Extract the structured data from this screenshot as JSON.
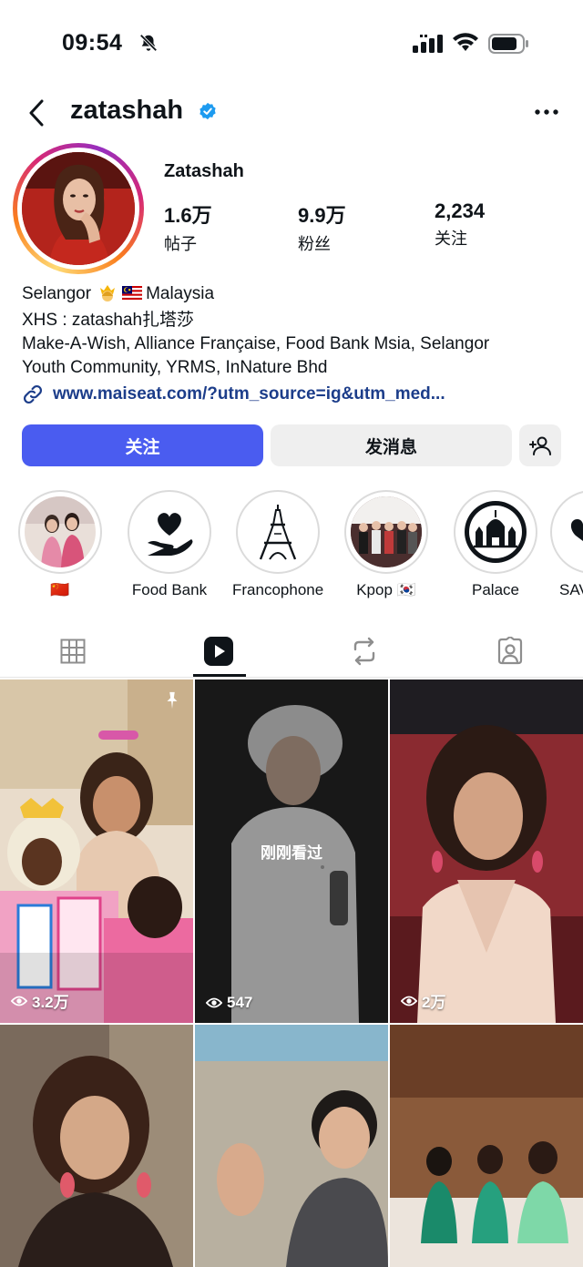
{
  "status_bar": {
    "time": "09:54"
  },
  "header": {
    "username": "zatashah"
  },
  "profile": {
    "display_name": "Zatashah",
    "stats": [
      {
        "value": "1.6万",
        "label": "帖子"
      },
      {
        "value": "9.9万",
        "label": "粉丝"
      },
      {
        "value": "2,234",
        "label": "关注"
      }
    ],
    "bio": {
      "location_left": "Selangor",
      "location_right": "Malaysia",
      "line2": "XHS : zatashah扎塔莎",
      "line3": "Make-A-Wish, Alliance Française, Food Bank Msia, Selangor",
      "line4": "Youth Community, YRMS, InNature Bhd"
    },
    "link": "www.maiseat.com/?utm_source=ig&utm_med..."
  },
  "actions": {
    "follow_label": "关注",
    "message_label": "发消息"
  },
  "highlights": [
    {
      "label": "🇨🇳"
    },
    {
      "label": "Food Bank"
    },
    {
      "label": "Francophone"
    },
    {
      "label": "Kpop 🇰🇷"
    },
    {
      "label": "Palace"
    },
    {
      "label": "SAV"
    }
  ],
  "tabs": [
    "grid-icon",
    "reels-icon",
    "reposts-icon",
    "tagged-icon"
  ],
  "grid": {
    "seen_label": "刚刚看过",
    "tiles": [
      {
        "views": "3.2万"
      },
      {
        "views": "547"
      },
      {
        "views": "2万"
      }
    ]
  },
  "colors": {
    "follow_blue": "#4a5cf0",
    "verified_blue": "#1d9bf0",
    "link_blue": "#1c3d8a"
  }
}
